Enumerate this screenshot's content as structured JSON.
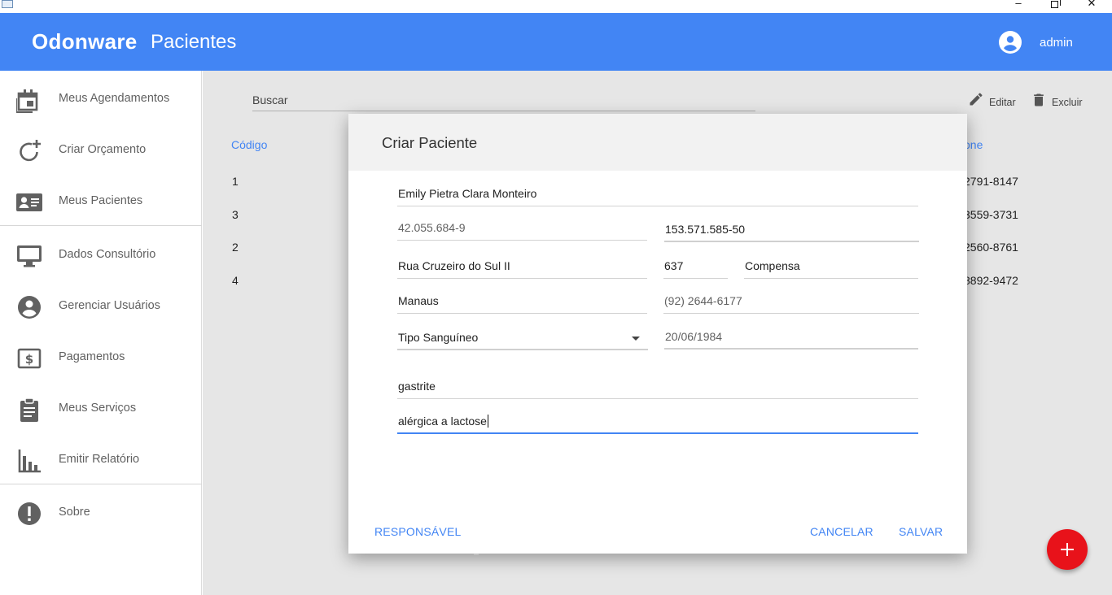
{
  "window": {
    "minimize": "–",
    "close": "✕"
  },
  "appbar": {
    "brand": "Odonware",
    "section": "Pacientes",
    "user": "admin"
  },
  "sidebar": {
    "items": [
      {
        "label": "Meus Agendamentos",
        "icon": "calendar-icon"
      },
      {
        "label": "Criar Orçamento",
        "icon": "add-circle-icon"
      },
      {
        "label": "Meus Pacientes",
        "icon": "patient-card-icon"
      },
      {
        "label": "Dados Consultório",
        "icon": "monitor-icon"
      },
      {
        "label": "Gerenciar Usuários",
        "icon": "account-icon"
      },
      {
        "label": "Pagamentos",
        "icon": "dollar-icon"
      },
      {
        "label": "Meus Serviços",
        "icon": "clipboard-icon"
      },
      {
        "label": "Emitir Relatório",
        "icon": "bar-chart-icon"
      },
      {
        "label": "Sobre",
        "icon": "info-alert-icon"
      }
    ]
  },
  "main": {
    "search_label": "Buscar",
    "edit_label": "Editar",
    "delete_label": "Excluir",
    "columns": {
      "code": "Código",
      "phone": "one"
    },
    "rows": [
      {
        "code": "1",
        "phone": "2791-8147"
      },
      {
        "code": "3",
        "phone": "3559-3731"
      },
      {
        "code": "2",
        "phone": "2560-8761"
      },
      {
        "code": "4",
        "phone": "8892-9472"
      }
    ]
  },
  "dialog": {
    "title": "Criar Paciente",
    "fields": {
      "name": "Emily Pietra Clara Monteiro",
      "rg": "42.055.684-9",
      "cpf": "153.571.585-50",
      "street": "Rua Cruzeiro do Sul II",
      "number": "637",
      "district": "Compensa",
      "city": "Manaus",
      "phone": "(92)  2644-6177",
      "blood_type": "Tipo Sanguíneo",
      "birth_date": "20/06/1984",
      "notes_1": "gastrite",
      "notes_2": "alérgica a lactose"
    },
    "buttons": {
      "responsible": "RESPONSÁVEL",
      "cancel": "CANCELAR",
      "save": "SALVAR"
    }
  },
  "colors": {
    "primary": "#4285f4",
    "fab": "#e8121a",
    "icon_gray": "#616161"
  }
}
